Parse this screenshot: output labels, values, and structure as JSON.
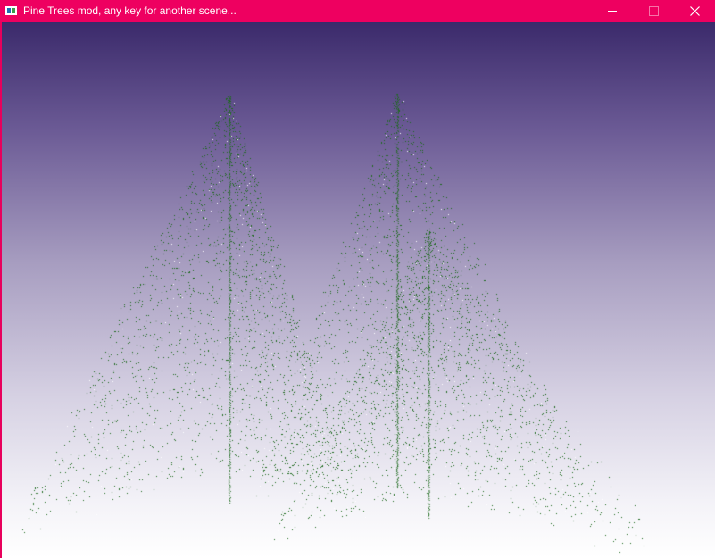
{
  "window": {
    "title": "Pine Trees mod, any key for another scene...",
    "icon": "app-window-icon",
    "controls": {
      "minimize_icon": "minimize-icon",
      "maximize_icon": "maximize-icon",
      "close_icon": "close-icon"
    }
  },
  "colors": {
    "titlebar": "#ee0060",
    "sky_top": "#3b2a6b",
    "sky_bottom": "#ffffff",
    "needles": "#1e6a1e",
    "snow": "#ffffff"
  },
  "scene": {
    "trees": [
      {
        "name": "left-pine"
      },
      {
        "name": "middle-pine"
      },
      {
        "name": "right-pine"
      }
    ]
  }
}
